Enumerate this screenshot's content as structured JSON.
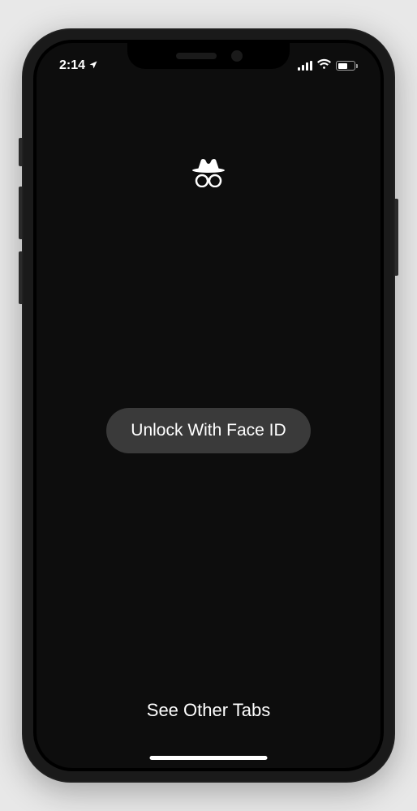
{
  "status_bar": {
    "time": "2:14",
    "location_enabled": true,
    "signal_strength": 4,
    "wifi_connected": true,
    "battery_percent": 60
  },
  "icon": {
    "name": "incognito-icon"
  },
  "main": {
    "unlock_button_label": "Unlock With Face ID",
    "other_tabs_label": "See Other Tabs"
  },
  "colors": {
    "background": "#0d0d0d",
    "button_bg": "#3a3a3a",
    "text": "#ffffff"
  }
}
